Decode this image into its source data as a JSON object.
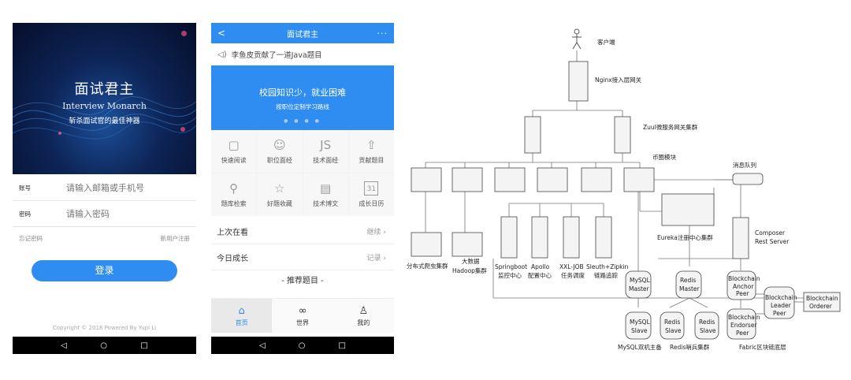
{
  "login": {
    "title": "面试君主",
    "subtitle": "Interview Monarch",
    "slogan": "斩杀面试官的最佳神器",
    "account_label": "账号",
    "account_placeholder": "请输入邮箱或手机号",
    "password_label": "密码",
    "password_placeholder": "请输入密码",
    "forgot": "忘记密码",
    "register": "新用户注册",
    "login_button": "登录",
    "copyright": "Copyright © 2018 Powered By Yupi Li",
    "nav": {
      "back": "◁",
      "home": "○",
      "recent": "□"
    }
  },
  "app": {
    "title": "面试君主",
    "back": "<",
    "more": "···",
    "notice": "李鱼皮贡献了一道Java题目",
    "banner_title": "校园知识少，就业困难",
    "banner_sub": "按职位定制学习路线",
    "banner_dots": "● ● ● ●",
    "grid": [
      {
        "icon": "book-icon",
        "glyph": "▢",
        "label": "快速阅读"
      },
      {
        "icon": "person-icon",
        "glyph": "☺",
        "label": "职位面经"
      },
      {
        "icon": "js-icon",
        "glyph": "JS",
        "label": "技术面经"
      },
      {
        "icon": "share-icon",
        "glyph": "⇧",
        "label": "贡献题目"
      },
      {
        "icon": "search-icon",
        "glyph": "⚲",
        "label": "题库检索"
      },
      {
        "icon": "star-icon",
        "glyph": "☆",
        "label": "好题收藏"
      },
      {
        "icon": "document-icon",
        "glyph": "▤",
        "label": "技术博文"
      },
      {
        "icon": "calendar-icon",
        "glyph": "31",
        "label": "成长日历"
      }
    ],
    "last_viewed": "上次在看",
    "continue": "继续 ›",
    "today_growth": "今日成长",
    "record": "记录 ›",
    "recommend": "- 推荐题目 -",
    "tabs": [
      {
        "icon": "home-icon",
        "glyph": "⌂",
        "label": "首页"
      },
      {
        "icon": "world-icon",
        "glyph": "∞",
        "label": "世界"
      },
      {
        "icon": "user-icon",
        "glyph": "♙",
        "label": "我的"
      }
    ],
    "nav": {
      "back": "◁",
      "home": "○",
      "recent": "□"
    }
  },
  "arch": {
    "client": "客户端",
    "nginx": "Nginx接入层网关",
    "zuul": "Zuul微服务网关集群",
    "coin": "币圈模块",
    "mq": "消息队列",
    "eureka": "Eureka注册中心集群",
    "composer1": "Composer",
    "composer2": "Rest Server",
    "crawler": "分布式爬虫集群",
    "bigdata1": "大数据",
    "bigdata2": "Hadoop集群",
    "springboot1": "Springboot",
    "springboot2": "监控中心",
    "apollo1": "Apollo",
    "apollo2": "配置中心",
    "xxl1": "XXL-JOB",
    "xxl2": "任务调度",
    "sleuth1": "Sleuth+Zipkin",
    "sleuth2": "链路追踪",
    "mysql_master1": "MySQL",
    "mysql_master2": "Master",
    "mysql_slave1": "MySQL",
    "mysql_slave2": "Slave",
    "mysql_cluster": "MySQL双机主备",
    "redis_master1": "Redis",
    "redis_master2": "Master",
    "redis_slave1": "Redis",
    "redis_slave2": "Slave",
    "redis_slave3": "Redis",
    "redis_slave4": "Slave",
    "redis_cluster": "Redis哨兵集群",
    "bc_anchor1": "Blockchain",
    "bc_anchor2": "Anchor",
    "bc_anchor3": "Peer",
    "bc_endorser1": "Blockchain",
    "bc_endorser2": "Endorser",
    "bc_endorser3": "Peer",
    "bc_leader1": "Blockchain",
    "bc_leader2": "Leader",
    "bc_leader3": "Peer",
    "bc_orderer1": "Blockchain",
    "bc_orderer2": "Orderer",
    "fabric": "Fabric区块链底层"
  }
}
